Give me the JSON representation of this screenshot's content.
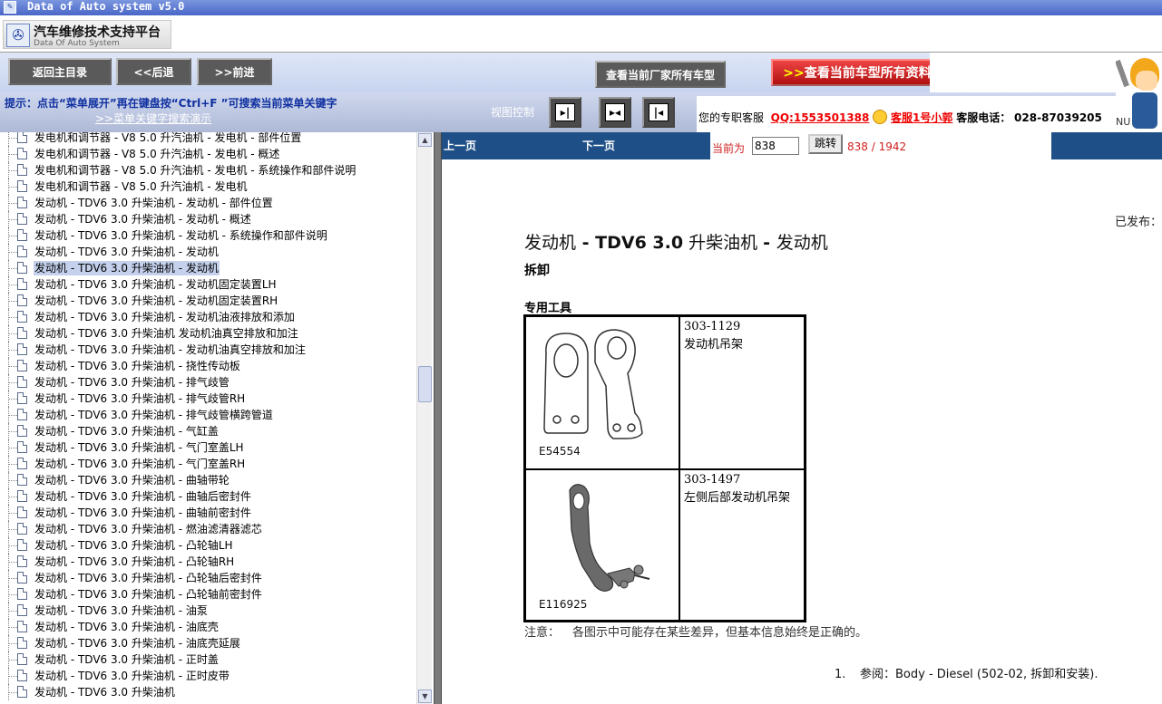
{
  "window": {
    "title": "Data of Auto system v5.0"
  },
  "logo": {
    "title": "汽车维修技术支持平台",
    "subtitle": "Data Of Auto System"
  },
  "toolbar": {
    "main_menu": "返回主目录",
    "back": "<<后退",
    "forward": ">>前进",
    "maker_models": "查看当前厂家所有车型",
    "all_info_arrows": ">>",
    "all_info": "查看当前车型所有资料"
  },
  "hint": {
    "text": "提示：点击“菜单展开”再在键盘按“Ctrl+F ”可搜索当前菜单关键字",
    "link": ">>菜单关键字搜索演示"
  },
  "view_control": {
    "label": "视图控制"
  },
  "service": {
    "label": "您的专职客服",
    "qq": "QQ:1553501388",
    "agent": "客服1号小郭",
    "phone_label": "客服电话：",
    "phone": "028-87039205"
  },
  "mascot": {
    "text": "NU"
  },
  "tree": {
    "items": [
      {
        "label": "发电机和调节器 - V8 5.0 升汽油机 - 发电机 - 部件位置"
      },
      {
        "label": "发电机和调节器 - V8 5.0 升汽油机 - 发电机 - 概述"
      },
      {
        "label": "发电机和调节器 - V8 5.0 升汽油机 - 发电机 - 系统操作和部件说明"
      },
      {
        "label": "发电机和调节器 - V8 5.0 升汽油机 - 发电机"
      },
      {
        "label": "发动机 - TDV6 3.0 升柴油机 - 发动机 - 部件位置"
      },
      {
        "label": "发动机 - TDV6 3.0 升柴油机 - 发动机 - 概述"
      },
      {
        "label": "发动机 - TDV6 3.0 升柴油机 - 发动机 - 系统操作和部件说明"
      },
      {
        "label": "发动机 - TDV6 3.0 升柴油机 - 发动机"
      },
      {
        "label": "发动机 - TDV6 3.0 升柴油机 - 发动机",
        "selected": true
      },
      {
        "label": "发动机 - TDV6 3.0 升柴油机 - 发动机固定装置LH"
      },
      {
        "label": "发动机 - TDV6 3.0 升柴油机 - 发动机固定装置RH"
      },
      {
        "label": "发动机 - TDV6 3.0 升柴油机 - 发动机油液排放和添加"
      },
      {
        "label": "发动机 - TDV6 3.0 升柴油机 发动机油真空排放和加注"
      },
      {
        "label": "发动机 - TDV6 3.0 升柴油机 - 发动机油真空排放和加注"
      },
      {
        "label": "发动机 - TDV6 3.0 升柴油机 - 挠性传动板"
      },
      {
        "label": "发动机 - TDV6 3.0 升柴油机 - 排气歧管"
      },
      {
        "label": "发动机 - TDV6 3.0 升柴油机 - 排气歧管RH"
      },
      {
        "label": "发动机 - TDV6 3.0 升柴油机 - 排气歧管横跨管道"
      },
      {
        "label": "发动机 - TDV6 3.0 升柴油机 - 气缸盖"
      },
      {
        "label": "发动机 - TDV6 3.0 升柴油机 - 气门室盖LH"
      },
      {
        "label": "发动机 - TDV6 3.0 升柴油机 - 气门室盖RH"
      },
      {
        "label": "发动机 - TDV6 3.0 升柴油机 - 曲轴带轮"
      },
      {
        "label": "发动机 - TDV6 3.0 升柴油机 - 曲轴后密封件"
      },
      {
        "label": "发动机 - TDV6 3.0 升柴油机 - 曲轴前密封件"
      },
      {
        "label": "发动机 - TDV6 3.0 升柴油机 - 燃油滤清器滤芯"
      },
      {
        "label": "发动机 - TDV6 3.0 升柴油机 - 凸轮轴LH"
      },
      {
        "label": "发动机 - TDV6 3.0 升柴油机 - 凸轮轴RH"
      },
      {
        "label": "发动机 - TDV6 3.0 升柴油机 - 凸轮轴后密封件"
      },
      {
        "label": "发动机 - TDV6 3.0 升柴油机 - 凸轮轴前密封件"
      },
      {
        "label": "发动机 - TDV6 3.0 升柴油机 - 油泵"
      },
      {
        "label": "发动机 - TDV6 3.0 升柴油机 - 油底壳"
      },
      {
        "label": "发动机 - TDV6 3.0 升柴油机 - 油底壳延展"
      },
      {
        "label": "发动机 - TDV6 3.0 升柴油机 - 正时盖"
      },
      {
        "label": "发动机 - TDV6 3.0 升柴油机 - 正时皮带"
      },
      {
        "label": "发动机 - TDV6 3.0 升柴油机"
      }
    ]
  },
  "pager": {
    "prev": "上一页",
    "next": "下一页",
    "current_label": "当前为",
    "current_value": "838",
    "jump": "跳转",
    "count": "838 / 1942"
  },
  "doc": {
    "published": "已发布：",
    "title_part1": "发动机",
    "title_dash1": " - ",
    "title_model": "TDV6 3.0",
    "title_part2": " 升柴油机 ",
    "title_dash2": "- ",
    "title_part3": "发动机",
    "subtitle": "拆卸",
    "tools_label": "专用工具",
    "tools": [
      {
        "number": "303-1129",
        "name": "发动机吊架",
        "figure": "E54554"
      },
      {
        "number": "303-1497",
        "name": "左侧后部发动机吊架",
        "figure": "E116925"
      }
    ],
    "note_label": "注意：",
    "note_text": "各图示中可能存在某些差异，但基本信息始终是正确的。",
    "step_number": "1.",
    "step_text": "参阅：Body - Diesel (502-02, 拆卸和安装)."
  }
}
